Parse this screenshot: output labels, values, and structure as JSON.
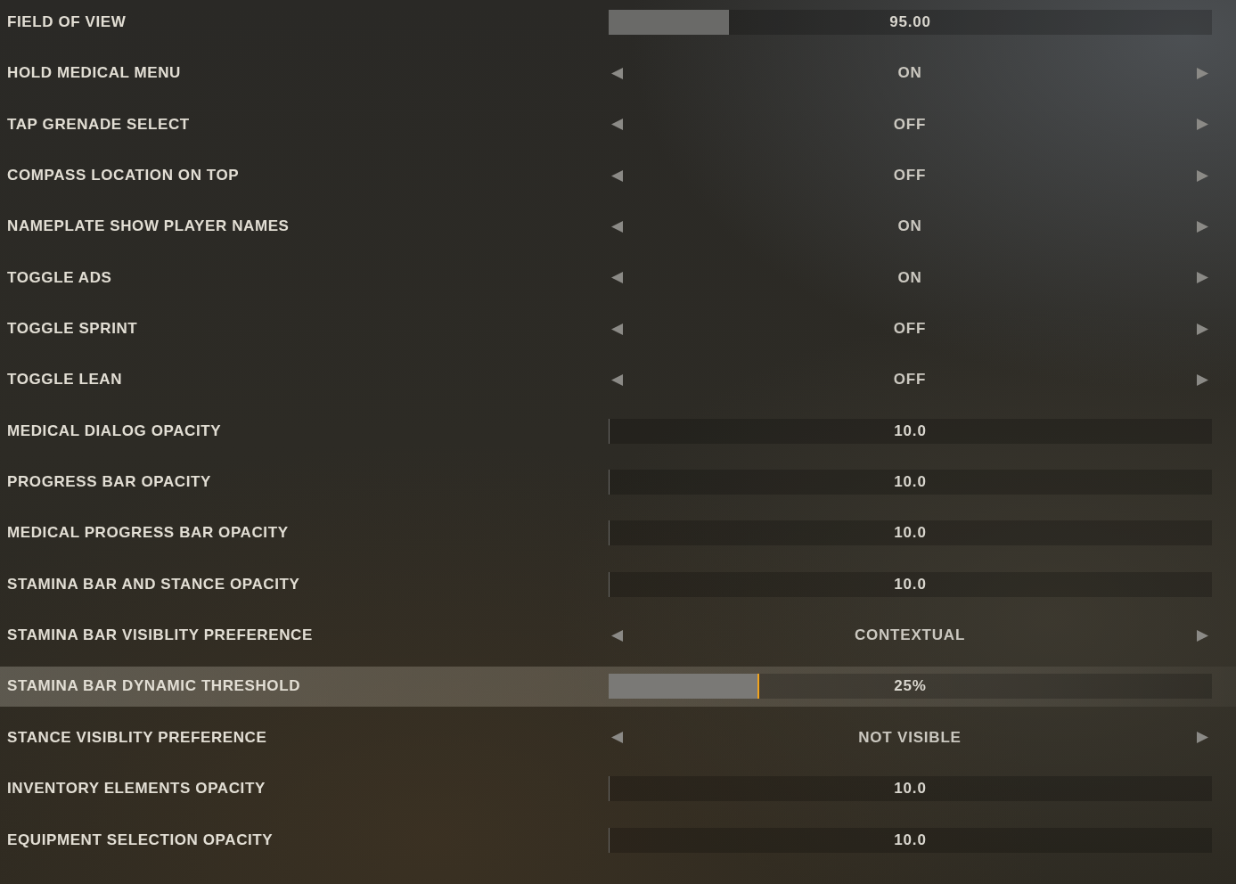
{
  "settings": [
    {
      "label": "FIELD OF VIEW",
      "kind": "slider",
      "value": "95.00",
      "level": 0.2,
      "selected": false
    },
    {
      "label": "HOLD MEDICAL MENU",
      "kind": "selector",
      "value": "ON",
      "selected": false
    },
    {
      "label": "TAP GRENADE SELECT",
      "kind": "selector",
      "value": "OFF",
      "selected": false
    },
    {
      "label": "COMPASS LOCATION ON TOP",
      "kind": "selector",
      "value": "OFF",
      "selected": false
    },
    {
      "label": "NAMEPLATE SHOW PLAYER NAMES",
      "kind": "selector",
      "value": "ON",
      "selected": false
    },
    {
      "label": "TOGGLE ADS",
      "kind": "selector",
      "value": "ON",
      "selected": false
    },
    {
      "label": "TOGGLE SPRINT",
      "kind": "selector",
      "value": "OFF",
      "selected": false
    },
    {
      "label": "TOGGLE LEAN",
      "kind": "selector",
      "value": "OFF",
      "selected": false
    },
    {
      "label": "MEDICAL DIALOG OPACITY",
      "kind": "slider",
      "value": "10.0",
      "level": 0,
      "selected": false
    },
    {
      "label": "PROGRESS BAR OPACITY",
      "kind": "slider",
      "value": "10.0",
      "level": 0,
      "selected": false
    },
    {
      "label": "MEDICAL PROGRESS BAR OPACITY",
      "kind": "slider",
      "value": "10.0",
      "level": 0,
      "selected": false
    },
    {
      "label": "STAMINA BAR AND STANCE OPACITY",
      "kind": "slider",
      "value": "10.0",
      "level": 0,
      "selected": false
    },
    {
      "label": "STAMINA BAR VISIBLITY PREFERENCE",
      "kind": "selector",
      "value": "CONTEXTUAL",
      "selected": false
    },
    {
      "label": "STAMINA BAR DYNAMIC THRESHOLD",
      "kind": "slider",
      "value": "25%",
      "level": 0.25,
      "selected": true
    },
    {
      "label": "STANCE VISIBLITY PREFERENCE",
      "kind": "selector",
      "value": "NOT VISIBLE",
      "selected": false
    },
    {
      "label": "INVENTORY ELEMENTS OPACITY",
      "kind": "slider",
      "value": "10.0",
      "level": 0,
      "selected": false
    },
    {
      "label": "EQUIPMENT SELECTION OPACITY",
      "kind": "slider",
      "value": "10.0",
      "level": 0,
      "selected": false
    }
  ]
}
